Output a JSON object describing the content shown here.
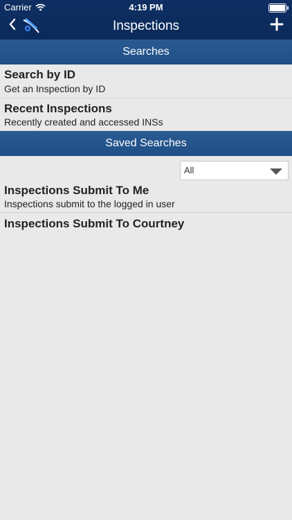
{
  "status": {
    "carrier": "Carrier",
    "time": "4:19 PM"
  },
  "nav": {
    "title": "Inspections",
    "back_icon": "chevron-left-icon",
    "add_icon": "plus-icon"
  },
  "sections": {
    "searches": "Searches",
    "saved": "Saved Searches"
  },
  "search_items": [
    {
      "title": "Search by ID",
      "subtitle": "Get an Inspection by ID"
    },
    {
      "title": "Recent Inspections",
      "subtitle": "Recently created and accessed INSs"
    }
  ],
  "filter": {
    "selected": "All"
  },
  "saved_items": [
    {
      "title": "Inspections Submit To Me",
      "subtitle": "Inspections submit to the logged in user"
    },
    {
      "title": "Inspections Submit To Courtney",
      "subtitle": ""
    }
  ],
  "colors": {
    "nav_bg": "#0f2f63",
    "section_bg": "#2a5a92",
    "page_bg": "#e9e9e9"
  }
}
